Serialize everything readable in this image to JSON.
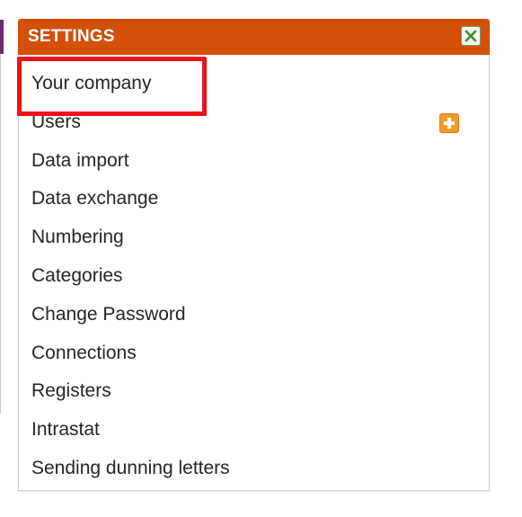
{
  "settings_panel": {
    "title": "SETTINGS",
    "close_icon": "close-x-icon",
    "header_color": "#d2500a",
    "items": [
      {
        "label": "Your company",
        "highlighted": true
      },
      {
        "label": "Users",
        "action_icon": "add-plus-icon"
      },
      {
        "label": "Data import"
      },
      {
        "label": "Data exchange"
      },
      {
        "label": "Numbering"
      },
      {
        "label": "Categories"
      },
      {
        "label": "Change Password"
      },
      {
        "label": "Connections"
      },
      {
        "label": "Registers"
      },
      {
        "label": "Intrastat"
      },
      {
        "label": "Sending dunning letters"
      }
    ]
  },
  "annotation": {
    "highlight_color": "#f0101a",
    "highlighted_item": "Your company"
  }
}
